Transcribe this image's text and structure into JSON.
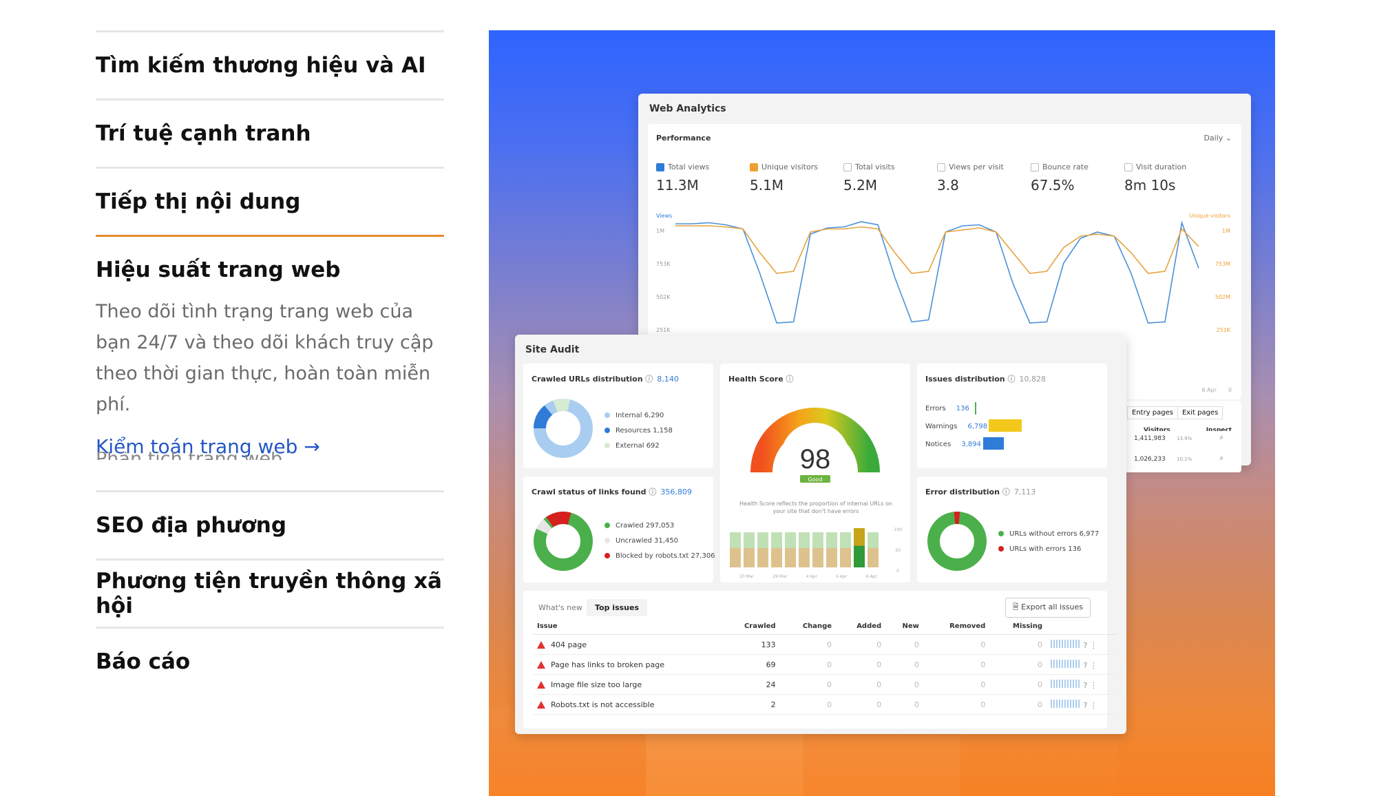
{
  "accordion": {
    "items_before": [
      {
        "label": "Tìm kiếm thương hiệu và AI"
      },
      {
        "label": "Trí tuệ cạnh tranh"
      },
      {
        "label": "Tiếp thị nội dung"
      }
    ],
    "open_item": {
      "title": "Hiệu suất trang web",
      "description": "Theo dõi tình trạng trang web của bạn 24/7 và theo dõi khách truy cập theo thời gian thực, hoàn toàn miễn phí.",
      "link": "Kiểm toán trang web →",
      "next_cut": "Phân tích trang web"
    },
    "items_after": [
      {
        "label": "SEO địa phương"
      },
      {
        "label": "Phương tiện truyền thông xã hội"
      },
      {
        "label": "Báo cáo"
      }
    ]
  },
  "web_analytics": {
    "title": "Web Analytics",
    "performance": "Performance",
    "period": "Daily",
    "metrics": [
      {
        "label": "Total views",
        "value": "11.3M",
        "checked": "blue"
      },
      {
        "label": "Unique visitors",
        "value": "5.1M",
        "checked": "orange"
      },
      {
        "label": "Total visits",
        "value": "5.2M",
        "checked": "none"
      },
      {
        "label": "Views per visit",
        "value": "3.8",
        "checked": "none"
      },
      {
        "label": "Bounce rate",
        "value": "67.5%",
        "checked": "none"
      },
      {
        "label": "Visit duration",
        "value": "8m 10s",
        "checked": "none"
      }
    ],
    "y_left_label": "Views",
    "y_right_label": "Unique visitors",
    "y_left_ticks": [
      "1M",
      "753K",
      "502K",
      "251K"
    ],
    "y_right_ticks": [
      "1M",
      "753M",
      "502M",
      "251K"
    ],
    "x_end": "6 Apr",
    "x_zero": "0",
    "views_series": [
      0.98,
      0.98,
      0.99,
      0.97,
      0.93,
      0.5,
      0.02,
      0.03,
      0.88,
      0.94,
      0.95,
      1.0,
      0.97,
      0.46,
      0.03,
      0.05,
      0.9,
      0.96,
      0.97,
      0.9,
      0.4,
      0.02,
      0.03,
      0.6,
      0.84,
      0.9,
      0.86,
      0.5,
      0.02,
      0.03,
      0.99,
      0.55
    ],
    "visitors_series": [
      0.96,
      0.96,
      0.96,
      0.95,
      0.93,
      0.7,
      0.5,
      0.52,
      0.9,
      0.93,
      0.93,
      0.95,
      0.93,
      0.7,
      0.5,
      0.52,
      0.9,
      0.92,
      0.94,
      0.9,
      0.7,
      0.5,
      0.52,
      0.75,
      0.86,
      0.88,
      0.86,
      0.7,
      0.5,
      0.52,
      0.93,
      0.76
    ],
    "side_tabs": [
      "Entry pages",
      "Exit pages"
    ],
    "side_cols": [
      "Visitors",
      "Inspect"
    ],
    "side_rows": [
      {
        "visitors": "1,411,983",
        "pct": "13.9%"
      },
      {
        "visitors": "1,026,233",
        "pct": "10.1%"
      }
    ]
  },
  "site_audit": {
    "title": "Site Audit",
    "crawled": {
      "title": "Crawled URLs distribution",
      "total": "8,140",
      "legend": [
        {
          "label": "Internal",
          "value": "6,290",
          "color": "#a9cdf0"
        },
        {
          "label": "Resources",
          "value": "1,158",
          "color": "#2f7bd8"
        },
        {
          "label": "External",
          "value": "692",
          "color": "#d7ead2"
        }
      ]
    },
    "health": {
      "title": "Health Score",
      "score": "98",
      "badge": "Good",
      "note": "Health Score reflects the proportion of internal URLs on your site that don't have errors",
      "bars": [
        0.85,
        0.85,
        0.85,
        0.85,
        0.85,
        0.85,
        0.85,
        0.85,
        0.85,
        0.95,
        0.85
      ],
      "x_labels": [
        "20 Mar",
        "29 Mar",
        "4 Apr",
        "6 Apr",
        "6 Apr"
      ],
      "y_labels": [
        "100",
        "50",
        "0"
      ]
    },
    "issues_dist": {
      "title": "Issues distribution",
      "total": "10,828",
      "rows": [
        {
          "label": "Errors",
          "value": "136",
          "color": "#2f7bd8",
          "share": 0.02
        },
        {
          "label": "Warnings",
          "value": "6,798",
          "color": "#f2c81a",
          "share": 0.63
        },
        {
          "label": "Notices",
          "value": "3,894",
          "color": "#2f7bd8",
          "share": 0.36
        }
      ]
    },
    "crawl_status": {
      "title": "Crawl status of links found",
      "total": "356,809",
      "legend": [
        {
          "label": "Crawled",
          "value": "297,053",
          "color": "#4bb04b"
        },
        {
          "label": "Uncrawled",
          "value": "31,450",
          "color": "#e6e6e6"
        },
        {
          "label": "Blocked by robots.txt",
          "value": "27,306",
          "color": "#d62020"
        }
      ]
    },
    "error_dist": {
      "title": "Error distribution",
      "total": "7,113",
      "legend": [
        {
          "label": "URLs without errors",
          "value": "6,977",
          "color": "#4bb04b"
        },
        {
          "label": "URLs with errors",
          "value": "136",
          "color": "#d62020"
        }
      ]
    },
    "tabs": [
      "What's new",
      "Top issues"
    ],
    "export": "Export all issues",
    "columns": [
      "Issue",
      "Crawled",
      "Change",
      "Added",
      "New",
      "Removed",
      "Missing"
    ],
    "rows": [
      {
        "issue": "404 page",
        "crawled": "133",
        "change": "0",
        "added": "0",
        "new": "0",
        "removed": "0",
        "missing": "0"
      },
      {
        "issue": "Page has links to broken page",
        "crawled": "69",
        "change": "0",
        "added": "0",
        "new": "0",
        "removed": "0",
        "missing": "0"
      },
      {
        "issue": "Image file size too large",
        "crawled": "24",
        "change": "0",
        "added": "0",
        "new": "0",
        "removed": "0",
        "missing": "0"
      },
      {
        "issue": "Robots.txt is not accessible",
        "crawled": "2",
        "change": "0",
        "added": "0",
        "new": "0",
        "removed": "0",
        "missing": "0"
      }
    ]
  }
}
